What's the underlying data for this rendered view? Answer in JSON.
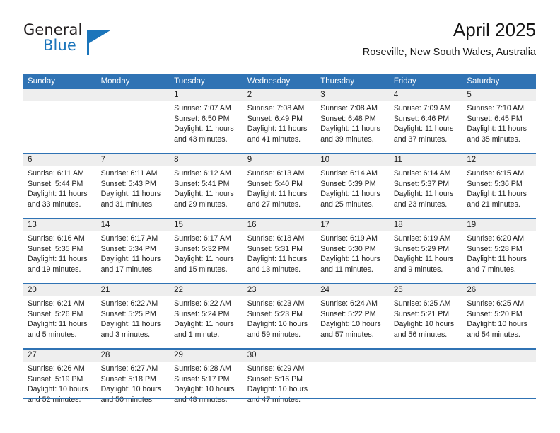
{
  "brand": {
    "name_part1": "General",
    "name_part2": "Blue",
    "logo_icon": "triangle-logo-icon"
  },
  "header": {
    "title": "April 2025",
    "subtitle": "Roseville, New South Wales, Australia"
  },
  "colors": {
    "header_blue": "#3073b4",
    "brand_blue": "#1b75bb",
    "daynum_band": "#eeeeee",
    "text": "#1a1a1a"
  },
  "calendar": {
    "weekday_headers": [
      "Sunday",
      "Monday",
      "Tuesday",
      "Wednesday",
      "Thursday",
      "Friday",
      "Saturday"
    ],
    "weeks": [
      [
        {
          "day": "",
          "sunrise": "",
          "sunset": "",
          "daylight_line1": "",
          "daylight_line2": ""
        },
        {
          "day": "",
          "sunrise": "",
          "sunset": "",
          "daylight_line1": "",
          "daylight_line2": ""
        },
        {
          "day": "1",
          "sunrise": "Sunrise: 7:07 AM",
          "sunset": "Sunset: 6:50 PM",
          "daylight_line1": "Daylight: 11 hours",
          "daylight_line2": "and 43 minutes."
        },
        {
          "day": "2",
          "sunrise": "Sunrise: 7:08 AM",
          "sunset": "Sunset: 6:49 PM",
          "daylight_line1": "Daylight: 11 hours",
          "daylight_line2": "and 41 minutes."
        },
        {
          "day": "3",
          "sunrise": "Sunrise: 7:08 AM",
          "sunset": "Sunset: 6:48 PM",
          "daylight_line1": "Daylight: 11 hours",
          "daylight_line2": "and 39 minutes."
        },
        {
          "day": "4",
          "sunrise": "Sunrise: 7:09 AM",
          "sunset": "Sunset: 6:46 PM",
          "daylight_line1": "Daylight: 11 hours",
          "daylight_line2": "and 37 minutes."
        },
        {
          "day": "5",
          "sunrise": "Sunrise: 7:10 AM",
          "sunset": "Sunset: 6:45 PM",
          "daylight_line1": "Daylight: 11 hours",
          "daylight_line2": "and 35 minutes."
        }
      ],
      [
        {
          "day": "6",
          "sunrise": "Sunrise: 6:11 AM",
          "sunset": "Sunset: 5:44 PM",
          "daylight_line1": "Daylight: 11 hours",
          "daylight_line2": "and 33 minutes."
        },
        {
          "day": "7",
          "sunrise": "Sunrise: 6:11 AM",
          "sunset": "Sunset: 5:43 PM",
          "daylight_line1": "Daylight: 11 hours",
          "daylight_line2": "and 31 minutes."
        },
        {
          "day": "8",
          "sunrise": "Sunrise: 6:12 AM",
          "sunset": "Sunset: 5:41 PM",
          "daylight_line1": "Daylight: 11 hours",
          "daylight_line2": "and 29 minutes."
        },
        {
          "day": "9",
          "sunrise": "Sunrise: 6:13 AM",
          "sunset": "Sunset: 5:40 PM",
          "daylight_line1": "Daylight: 11 hours",
          "daylight_line2": "and 27 minutes."
        },
        {
          "day": "10",
          "sunrise": "Sunrise: 6:14 AM",
          "sunset": "Sunset: 5:39 PM",
          "daylight_line1": "Daylight: 11 hours",
          "daylight_line2": "and 25 minutes."
        },
        {
          "day": "11",
          "sunrise": "Sunrise: 6:14 AM",
          "sunset": "Sunset: 5:37 PM",
          "daylight_line1": "Daylight: 11 hours",
          "daylight_line2": "and 23 minutes."
        },
        {
          "day": "12",
          "sunrise": "Sunrise: 6:15 AM",
          "sunset": "Sunset: 5:36 PM",
          "daylight_line1": "Daylight: 11 hours",
          "daylight_line2": "and 21 minutes."
        }
      ],
      [
        {
          "day": "13",
          "sunrise": "Sunrise: 6:16 AM",
          "sunset": "Sunset: 5:35 PM",
          "daylight_line1": "Daylight: 11 hours",
          "daylight_line2": "and 19 minutes."
        },
        {
          "day": "14",
          "sunrise": "Sunrise: 6:17 AM",
          "sunset": "Sunset: 5:34 PM",
          "daylight_line1": "Daylight: 11 hours",
          "daylight_line2": "and 17 minutes."
        },
        {
          "day": "15",
          "sunrise": "Sunrise: 6:17 AM",
          "sunset": "Sunset: 5:32 PM",
          "daylight_line1": "Daylight: 11 hours",
          "daylight_line2": "and 15 minutes."
        },
        {
          "day": "16",
          "sunrise": "Sunrise: 6:18 AM",
          "sunset": "Sunset: 5:31 PM",
          "daylight_line1": "Daylight: 11 hours",
          "daylight_line2": "and 13 minutes."
        },
        {
          "day": "17",
          "sunrise": "Sunrise: 6:19 AM",
          "sunset": "Sunset: 5:30 PM",
          "daylight_line1": "Daylight: 11 hours",
          "daylight_line2": "and 11 minutes."
        },
        {
          "day": "18",
          "sunrise": "Sunrise: 6:19 AM",
          "sunset": "Sunset: 5:29 PM",
          "daylight_line1": "Daylight: 11 hours",
          "daylight_line2": "and 9 minutes."
        },
        {
          "day": "19",
          "sunrise": "Sunrise: 6:20 AM",
          "sunset": "Sunset: 5:28 PM",
          "daylight_line1": "Daylight: 11 hours",
          "daylight_line2": "and 7 minutes."
        }
      ],
      [
        {
          "day": "20",
          "sunrise": "Sunrise: 6:21 AM",
          "sunset": "Sunset: 5:26 PM",
          "daylight_line1": "Daylight: 11 hours",
          "daylight_line2": "and 5 minutes."
        },
        {
          "day": "21",
          "sunrise": "Sunrise: 6:22 AM",
          "sunset": "Sunset: 5:25 PM",
          "daylight_line1": "Daylight: 11 hours",
          "daylight_line2": "and 3 minutes."
        },
        {
          "day": "22",
          "sunrise": "Sunrise: 6:22 AM",
          "sunset": "Sunset: 5:24 PM",
          "daylight_line1": "Daylight: 11 hours",
          "daylight_line2": "and 1 minute."
        },
        {
          "day": "23",
          "sunrise": "Sunrise: 6:23 AM",
          "sunset": "Sunset: 5:23 PM",
          "daylight_line1": "Daylight: 10 hours",
          "daylight_line2": "and 59 minutes."
        },
        {
          "day": "24",
          "sunrise": "Sunrise: 6:24 AM",
          "sunset": "Sunset: 5:22 PM",
          "daylight_line1": "Daylight: 10 hours",
          "daylight_line2": "and 57 minutes."
        },
        {
          "day": "25",
          "sunrise": "Sunrise: 6:25 AM",
          "sunset": "Sunset: 5:21 PM",
          "daylight_line1": "Daylight: 10 hours",
          "daylight_line2": "and 56 minutes."
        },
        {
          "day": "26",
          "sunrise": "Sunrise: 6:25 AM",
          "sunset": "Sunset: 5:20 PM",
          "daylight_line1": "Daylight: 10 hours",
          "daylight_line2": "and 54 minutes."
        }
      ],
      [
        {
          "day": "27",
          "sunrise": "Sunrise: 6:26 AM",
          "sunset": "Sunset: 5:19 PM",
          "daylight_line1": "Daylight: 10 hours",
          "daylight_line2": "and 52 minutes."
        },
        {
          "day": "28",
          "sunrise": "Sunrise: 6:27 AM",
          "sunset": "Sunset: 5:18 PM",
          "daylight_line1": "Daylight: 10 hours",
          "daylight_line2": "and 50 minutes."
        },
        {
          "day": "29",
          "sunrise": "Sunrise: 6:28 AM",
          "sunset": "Sunset: 5:17 PM",
          "daylight_line1": "Daylight: 10 hours",
          "daylight_line2": "and 48 minutes."
        },
        {
          "day": "30",
          "sunrise": "Sunrise: 6:29 AM",
          "sunset": "Sunset: 5:16 PM",
          "daylight_line1": "Daylight: 10 hours",
          "daylight_line2": "and 47 minutes."
        },
        {
          "day": "",
          "sunrise": "",
          "sunset": "",
          "daylight_line1": "",
          "daylight_line2": ""
        },
        {
          "day": "",
          "sunrise": "",
          "sunset": "",
          "daylight_line1": "",
          "daylight_line2": ""
        },
        {
          "day": "",
          "sunrise": "",
          "sunset": "",
          "daylight_line1": "",
          "daylight_line2": ""
        }
      ]
    ]
  }
}
